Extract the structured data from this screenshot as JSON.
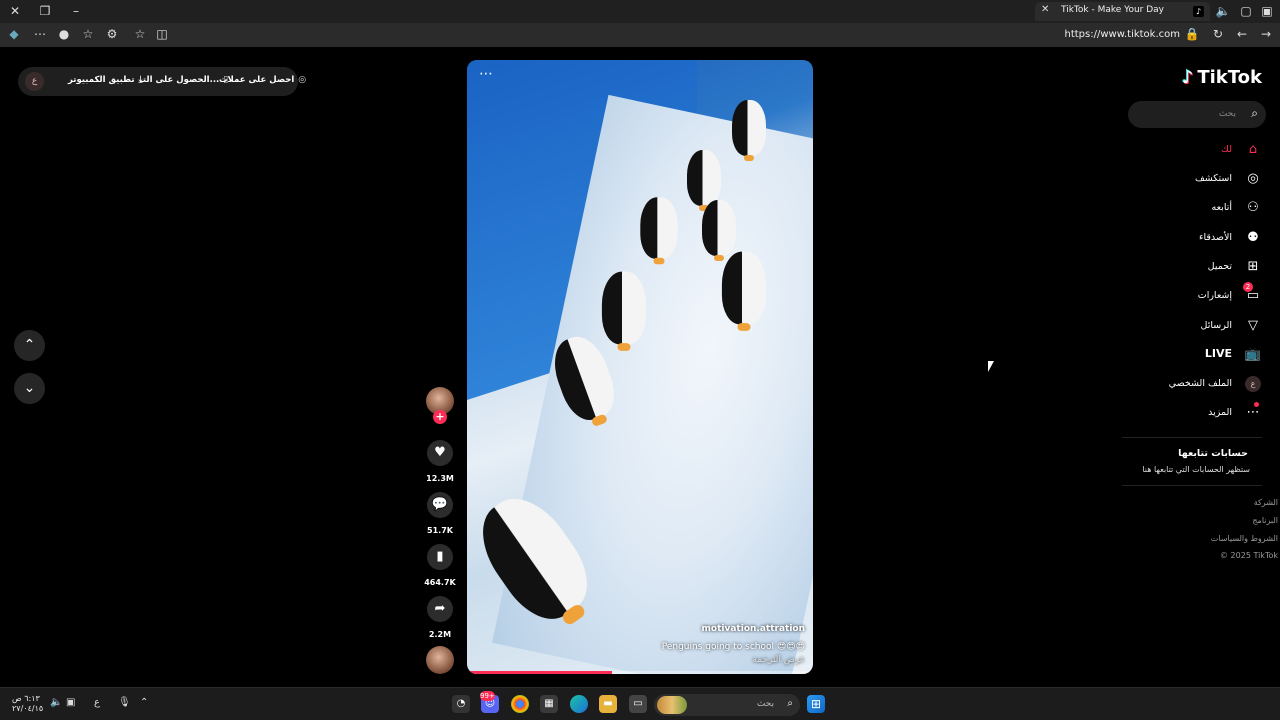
{
  "browser": {
    "tab_title": "TikTok - Make Your Day",
    "url": "https://www.tiktok.com"
  },
  "topbar": {
    "avatar_letter": "ع",
    "coins_label": "احصل على عملات",
    "get_app_label": "الحصول على التـ...",
    "desktop_app_label": "تطبيق الكمبيوتر"
  },
  "video": {
    "username": "motivation.attration",
    "caption": "Penguins going to school 😍😍😍",
    "translate_label": "عرض الترجمة",
    "progress_fraction": 0.42
  },
  "rail": {
    "likes": "12.3M",
    "comments": "51.7K",
    "saves": "464.7K",
    "shares": "2.2M"
  },
  "sidebar": {
    "logo_text": "TikTok",
    "search_placeholder": "بحث",
    "items": [
      {
        "label": "لك"
      },
      {
        "label": "استكشف"
      },
      {
        "label": "أتابعه"
      },
      {
        "label": "الأصدقاء"
      },
      {
        "label": "تحميل"
      },
      {
        "label": "إشعارات",
        "badge": "2"
      },
      {
        "label": "الرسائل"
      },
      {
        "label": "LIVE"
      },
      {
        "label": "الملف الشخصي",
        "avatar_letter": "ع"
      },
      {
        "label": "المزيد"
      }
    ],
    "following_title": "حسابات تتابعها",
    "following_hint": "ستظهر الحسابات التي تتابعها هنا",
    "footer": [
      "الشركة",
      "البرنامج",
      "الشروط والسياسات",
      "© 2025 TikTok"
    ]
  },
  "taskbar": {
    "time": "٦:١٣ ص",
    "date": "٢٧/٠٤/١٥",
    "lang": "ع",
    "search_placeholder": "بحث",
    "discord_badge": "99+"
  },
  "colors": {
    "accent": "#fe2c55",
    "background": "#000000",
    "panel": "#1f1f1f"
  }
}
